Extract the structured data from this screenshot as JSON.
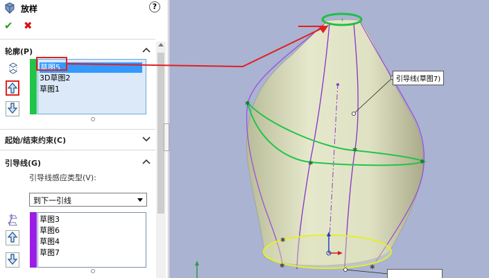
{
  "feature": {
    "title": "放样",
    "help_label": "?",
    "ok_symbol": "✔",
    "cancel_symbol": "✖"
  },
  "profiles": {
    "header": "轮廓(P)",
    "items": [
      "草图5",
      "3D草图2",
      "草图1"
    ],
    "selected_index": 0
  },
  "start_end": {
    "header": "起始/结束约束(C)"
  },
  "guides": {
    "header": "引导线(G)",
    "influence_label": "引导线感应类型(V):",
    "influence_value": "到下一引线",
    "items": [
      "草图3",
      "草图6",
      "草图4",
      "草图7"
    ]
  },
  "viewport": {
    "callout_guide": "引导线(草图7)",
    "colors": {
      "background": "#aab3d2",
      "body": "#e2e4c7",
      "profile_green": "#22c44a",
      "profile_yellow": "#e3f02a",
      "guide_purple": "#8a3cc8",
      "annotation_red": "#e02020"
    }
  },
  "icons": {
    "title": "loft-icon",
    "profile_section": "profile-icon",
    "guide_section": "guide-curve-icon"
  }
}
